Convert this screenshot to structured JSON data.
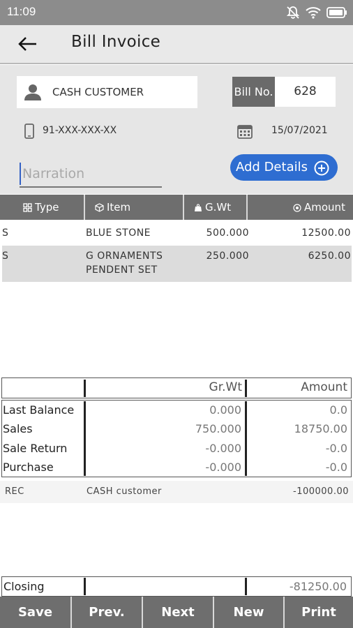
{
  "status_bar": {
    "time": "11:09"
  },
  "app_bar": {
    "title": "Bill Invoice"
  },
  "header": {
    "customer_name": "CASH CUSTOMER",
    "bill_label": "Bill No.",
    "bill_no": "628",
    "phone": "91-XXX-XXX-XX",
    "date": "15/07/2021",
    "narration_placeholder": "Narration",
    "add_details_label": "Add Details"
  },
  "table": {
    "columns": [
      "Type",
      "Item",
      "G.Wt",
      "Amount"
    ],
    "rows": [
      {
        "type": "S",
        "item_line1": "BLUE STONE",
        "item_line2": "",
        "gwt": "500.000",
        "amount": "12500.00"
      },
      {
        "type": "S",
        "item_line1": "G ORNAMENTS",
        "item_line2": "PENDENT SET",
        "gwt": "250.000",
        "amount": "6250.00"
      }
    ]
  },
  "summary": {
    "col_grwt": "Gr.Wt",
    "col_amount": "Amount",
    "rows": [
      {
        "label": "Last Balance",
        "grwt": "0.000",
        "amount": "0.0"
      },
      {
        "label": "Sales",
        "grwt": "750.000",
        "amount": "18750.00"
      },
      {
        "label": "Sale Return",
        "grwt": "-0.000",
        "amount": "-0.0"
      },
      {
        "label": "Purchase",
        "grwt": "-0.000",
        "amount": "-0.0"
      }
    ]
  },
  "receipt": {
    "type": "REC",
    "name": "CASH customer",
    "amount": "-100000.00"
  },
  "closing": {
    "label": "Closing",
    "amount": "-81250.00"
  },
  "buttons": {
    "save": "Save",
    "prev": "Prev.",
    "next": "Next",
    "new": "New",
    "print": "Print"
  },
  "colors": {
    "accent_blue": "#2e6dd1",
    "header_gray": "#6e6e6e",
    "panel_gray": "#e6e6e6"
  }
}
